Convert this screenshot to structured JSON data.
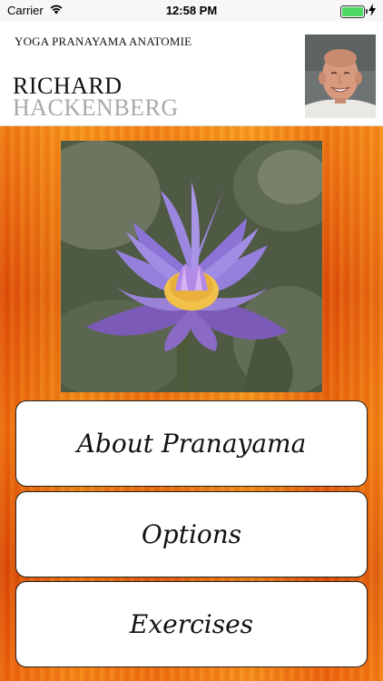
{
  "status_bar": {
    "carrier": "Carrier",
    "time": "12:58 PM",
    "battery_level": 1.0,
    "battery_color": "#4cd964"
  },
  "header": {
    "app_subtitle": "YOGA PRANAYAMA ANATOMIE",
    "first_name": "RICHARD",
    "last_name": "HACKENBERG"
  },
  "menu": {
    "about_label": "About Pranayama",
    "options_label": "Options",
    "exercises_label": "Exercises"
  },
  "colors": {
    "background_accent": "#e8620e",
    "last_name_gray": "#a9a9a9"
  }
}
